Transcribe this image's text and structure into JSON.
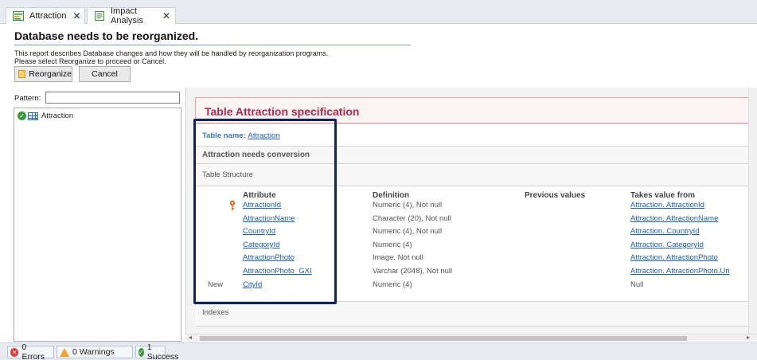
{
  "tabs": [
    {
      "label": "Attraction"
    },
    {
      "label": "Impact Analysis"
    }
  ],
  "header": {
    "title": "Database needs to be reorganized.",
    "description": "This report describes Database changes and how they will be handled by reorganization programs.",
    "instruction": "Please select Reorganize to proceed or Cancel.",
    "reorganize_label": "Reorganize",
    "cancel_label": "Cancel"
  },
  "filter": {
    "pattern_label": "Pattern:",
    "pattern_value": ""
  },
  "tree": {
    "items": [
      {
        "label": "Attraction",
        "status": "success"
      }
    ]
  },
  "spec": {
    "title": "Table Attraction specification",
    "table_name_label": "Table name:",
    "table_name_link": "Attraction",
    "conversion_note": "Attraction needs conversion",
    "structure_label": "Table Structure",
    "columns": {
      "attribute": "Attribute",
      "definition": "Definition",
      "previous": "Previous values",
      "takes_from": "Takes value from"
    },
    "rows": [
      {
        "status": "",
        "key": true,
        "attribute": "AttractionId",
        "definition": "Numeric (4), Not null",
        "previous": "",
        "takes_from": "Attraction. AttractionId"
      },
      {
        "status": "",
        "key": false,
        "attribute": "AttractionName",
        "definition": "Character (20), Not null",
        "previous": "",
        "takes_from": "Attraction. AttractionName"
      },
      {
        "status": "",
        "key": false,
        "attribute": "CountryId",
        "definition": "Numeric (4), Not null",
        "previous": "",
        "takes_from": "Attraction. CountryId"
      },
      {
        "status": "",
        "key": false,
        "attribute": "CategoryId",
        "definition": "Numeric (4)",
        "previous": "",
        "takes_from": "Attraction. CategoryId"
      },
      {
        "status": "",
        "key": false,
        "attribute": "AttractionPhoto",
        "definition": "Image, Not null",
        "previous": "",
        "takes_from": "Attraction. AttractionPhoto"
      },
      {
        "status": "",
        "key": false,
        "attribute": "AttractionPhoto_GXI",
        "definition": "Varchar (2048), Not null",
        "previous": "",
        "takes_from": "Attraction. AttractionPhoto.Uri"
      },
      {
        "status": "New",
        "key": false,
        "attribute": "CityId",
        "definition": "Numeric (4)",
        "previous": "",
        "takes_from": "Null"
      }
    ],
    "indexes_label": "Indexes"
  },
  "statusbar": {
    "errors": "0 Errors",
    "warnings": "0 Warnings",
    "success": "1 Success"
  },
  "colors": {
    "spec_title": "#b0294a",
    "link": "#1f5fb0",
    "highlight_border": "#12235c"
  }
}
